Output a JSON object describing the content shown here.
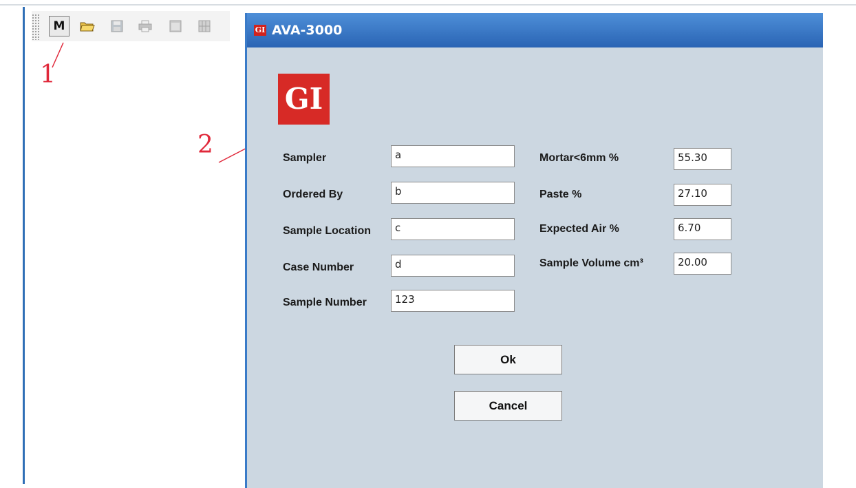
{
  "toolbar": {
    "buttons": [
      {
        "name": "m-button",
        "label": "M",
        "icon": "letter-m"
      },
      {
        "name": "open-folder-button",
        "icon": "open-folder-icon"
      },
      {
        "name": "save-button",
        "icon": "save-icon"
      },
      {
        "name": "print-button",
        "icon": "printer-icon"
      },
      {
        "name": "window-button",
        "icon": "window-icon"
      },
      {
        "name": "grid-button",
        "icon": "grid-icon"
      }
    ]
  },
  "annotations": {
    "one": "1",
    "two": "2",
    "color": "#e0283a"
  },
  "dialog": {
    "title": "AVA-3000",
    "title_icon": "GI",
    "logo": "GI",
    "fields_left": [
      {
        "label": "Sampler",
        "value": "a"
      },
      {
        "label": "Ordered By",
        "value": "b"
      },
      {
        "label": "Sample Location",
        "value": "c"
      },
      {
        "label": "Case Number",
        "value": "d"
      },
      {
        "label": "Sample Number",
        "value": "123"
      }
    ],
    "fields_right": [
      {
        "label": "Mortar<6mm %",
        "value": "55.30"
      },
      {
        "label": "Paste %",
        "value": "27.10"
      },
      {
        "label": "Expected Air %",
        "value": "6.70"
      },
      {
        "label": "Sample Volume cm³",
        "value": "20.00"
      }
    ],
    "ok_label": "Ok",
    "cancel_label": "Cancel"
  },
  "colors": {
    "accent": "#2f6fb6",
    "logo_red": "#d72a26",
    "dialog_bg": "#ccd7e1"
  }
}
